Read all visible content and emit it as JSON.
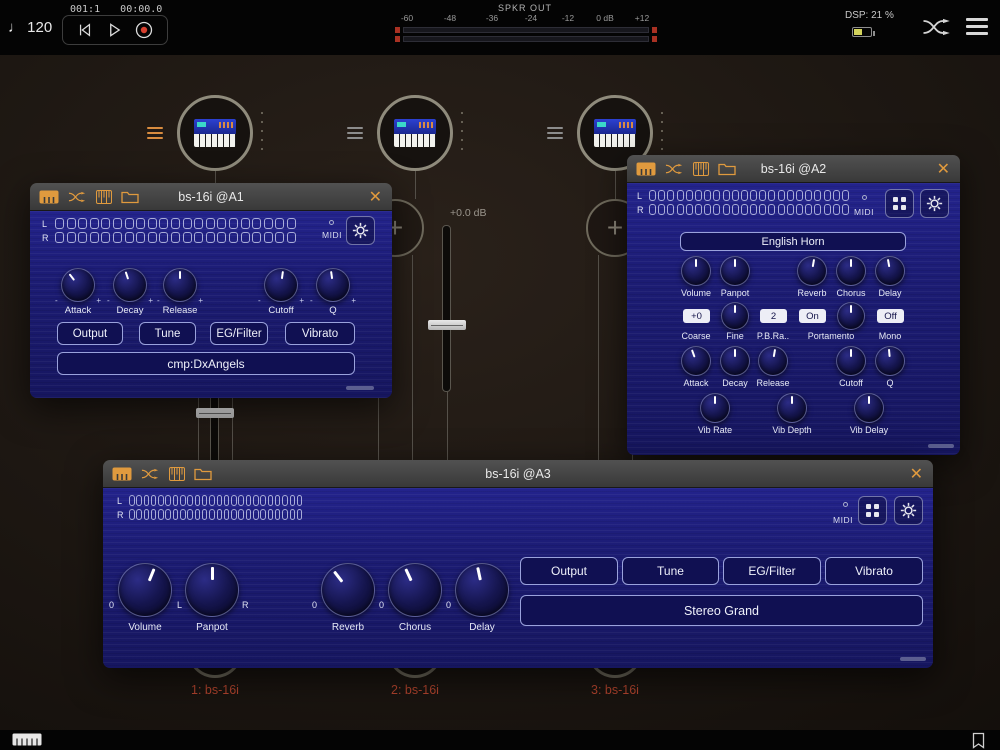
{
  "ui": {
    "close_glyph": "✕",
    "plus_glyph": "+"
  },
  "topbar": {
    "tempo_note": "♩",
    "tempo_value": "120",
    "time_bars": "001:1",
    "time_clock": "00:00.0",
    "meter_title": "SPKR OUT",
    "meter_ticks": [
      "-60",
      "-48",
      "-36",
      "-24",
      "-12",
      "0 dB",
      "+12"
    ],
    "dsp_label": "DSP: 21 %"
  },
  "graph": {
    "fader_db": "+0.0 dB",
    "speaker_label": "SPKR",
    "captions": [
      "1: bs-16i",
      "2: bs-16i",
      "3: bs-16i"
    ]
  },
  "win_a1": {
    "title": "bs-16i @A1",
    "meter_l": "L",
    "meter_r": "R",
    "midi_label": "MIDI",
    "knob_labels": [
      "Attack",
      "Decay",
      "Release",
      "Cutoff",
      "Q"
    ],
    "tab_buttons": [
      "Output",
      "Tune",
      "EG/Filter",
      "Vibrato"
    ],
    "preset": "cmp:DxAngels"
  },
  "win_a2": {
    "title": "bs-16i @A2",
    "meter_l": "L",
    "meter_r": "R",
    "midi_label": "MIDI",
    "preset": "English Horn",
    "row1_labels": [
      "Volume",
      "Panpot",
      "Reverb",
      "Chorus",
      "Delay"
    ],
    "coarse_value": "+0",
    "pbrange_value": "2",
    "portamento_value": "On",
    "mono_value": "Off",
    "row2_labels": [
      "Coarse",
      "Fine",
      "P.B.Ra..",
      "Portamento",
      "Mono"
    ],
    "row3_labels": [
      "Attack",
      "Decay",
      "Release",
      "Cutoff",
      "Q"
    ],
    "row4_labels": [
      "Vib Rate",
      "Vib Depth",
      "Vib Delay"
    ]
  },
  "win_a3": {
    "title": "bs-16i @A3",
    "meter_l": "L",
    "meter_r": "R",
    "midi_label": "MIDI",
    "knob_labels": [
      "Volume",
      "Panpot",
      "Reverb",
      "Chorus",
      "Delay"
    ],
    "knob_zero": "0",
    "pan_l": "L",
    "pan_r": "R",
    "tab_buttons": [
      "Output",
      "Tune",
      "EG/Filter",
      "Vibrato"
    ],
    "preset": "Stereo Grand"
  }
}
